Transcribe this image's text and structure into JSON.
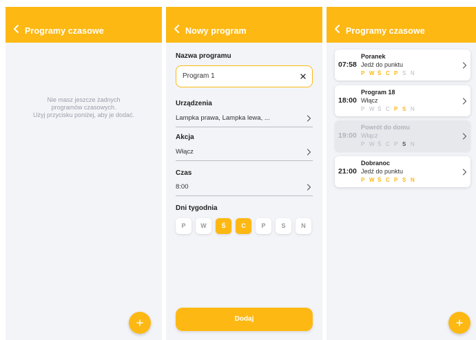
{
  "colors": {
    "accent": "#fdb813",
    "background": "#f3f4f8"
  },
  "screen_empty": {
    "title": "Programy czasowe",
    "empty_lines": [
      "Nie masz jeszcze żadnych",
      "programów czasowych.",
      "Użyj przycisku poniżej, aby je dodać."
    ],
    "fab_icon": "plus-icon"
  },
  "screen_new": {
    "title": "Nowy program",
    "name_label": "Nazwa programu",
    "name_value": "Program 1",
    "devices_label": "Urządzenia",
    "devices_value": "Lampka prawa, Lampka lewa, ...",
    "action_label": "Akcja",
    "action_value": "Włącz",
    "time_label": "Czas",
    "time_value": "8:00",
    "days_label": "Dni tygodnia",
    "days": [
      {
        "label": "P",
        "selected": false
      },
      {
        "label": "W",
        "selected": false
      },
      {
        "label": "Ś",
        "selected": true
      },
      {
        "label": "C",
        "selected": true
      },
      {
        "label": "P",
        "selected": false
      },
      {
        "label": "S",
        "selected": false
      },
      {
        "label": "N",
        "selected": false
      }
    ],
    "submit_label": "Dodaj"
  },
  "screen_list": {
    "title": "Programy czasowe",
    "day_letters": [
      "P",
      "W",
      "Ś",
      "C",
      "P",
      "S",
      "N"
    ],
    "programs": [
      {
        "time": "07:58",
        "name": "Poranek",
        "action": "Jedź do punktu",
        "active_days": [
          0,
          1,
          2,
          3,
          4
        ],
        "enabled": true
      },
      {
        "time": "18:00",
        "name": "Program 18",
        "action": "Włącz",
        "active_days": [
          4,
          5
        ],
        "enabled": true
      },
      {
        "time": "19:00",
        "name": "Powrót do domu",
        "action": "Włącz",
        "active_days": [
          5
        ],
        "enabled": false
      },
      {
        "time": "21:00",
        "name": "Dobranoc",
        "action": "Jedź do punktu",
        "active_days": [
          0,
          1,
          2,
          3,
          4,
          5,
          6
        ],
        "enabled": true
      }
    ],
    "fab_icon": "plus-icon"
  }
}
